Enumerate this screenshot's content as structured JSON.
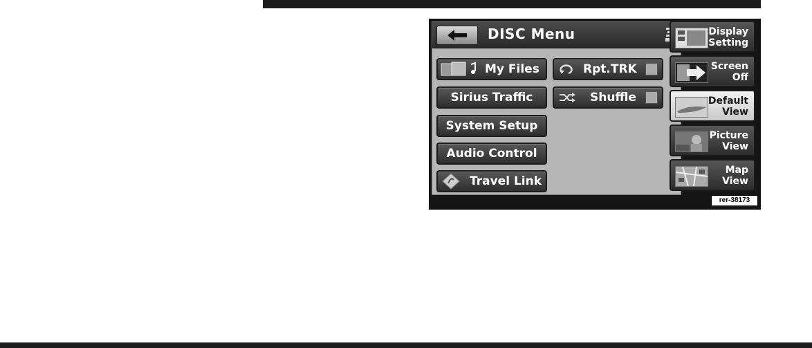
{
  "header": {
    "title": "DISC Menu"
  },
  "menu_left": [
    {
      "label": "My Files",
      "icon": "music-files-icon"
    },
    {
      "label": "Sirius Traffic"
    },
    {
      "label": "System Setup"
    },
    {
      "label": "Audio Control"
    },
    {
      "label": "Travel Link",
      "icon": "travel-link-icon"
    }
  ],
  "menu_right": [
    {
      "label": "Rpt.TRK",
      "icon": "repeat-icon",
      "checked": false
    },
    {
      "label": "Shuffle",
      "icon": "shuffle-icon",
      "checked": false
    }
  ],
  "side_buttons": [
    {
      "line1": "Display",
      "line2": "Setting",
      "active": false
    },
    {
      "line1": "Screen",
      "line2": "Off",
      "active": false
    },
    {
      "line1": "Default",
      "line2": "View",
      "active": true
    },
    {
      "line1": "Picture",
      "line2": "View",
      "active": false
    },
    {
      "line1": "Map",
      "line2": "View",
      "active": false
    }
  ],
  "figure_code": "rer-38173",
  "colors": {
    "panel": "#b5b5b5",
    "button": "#3c3c3c",
    "active_button": "#e0e0e0"
  }
}
